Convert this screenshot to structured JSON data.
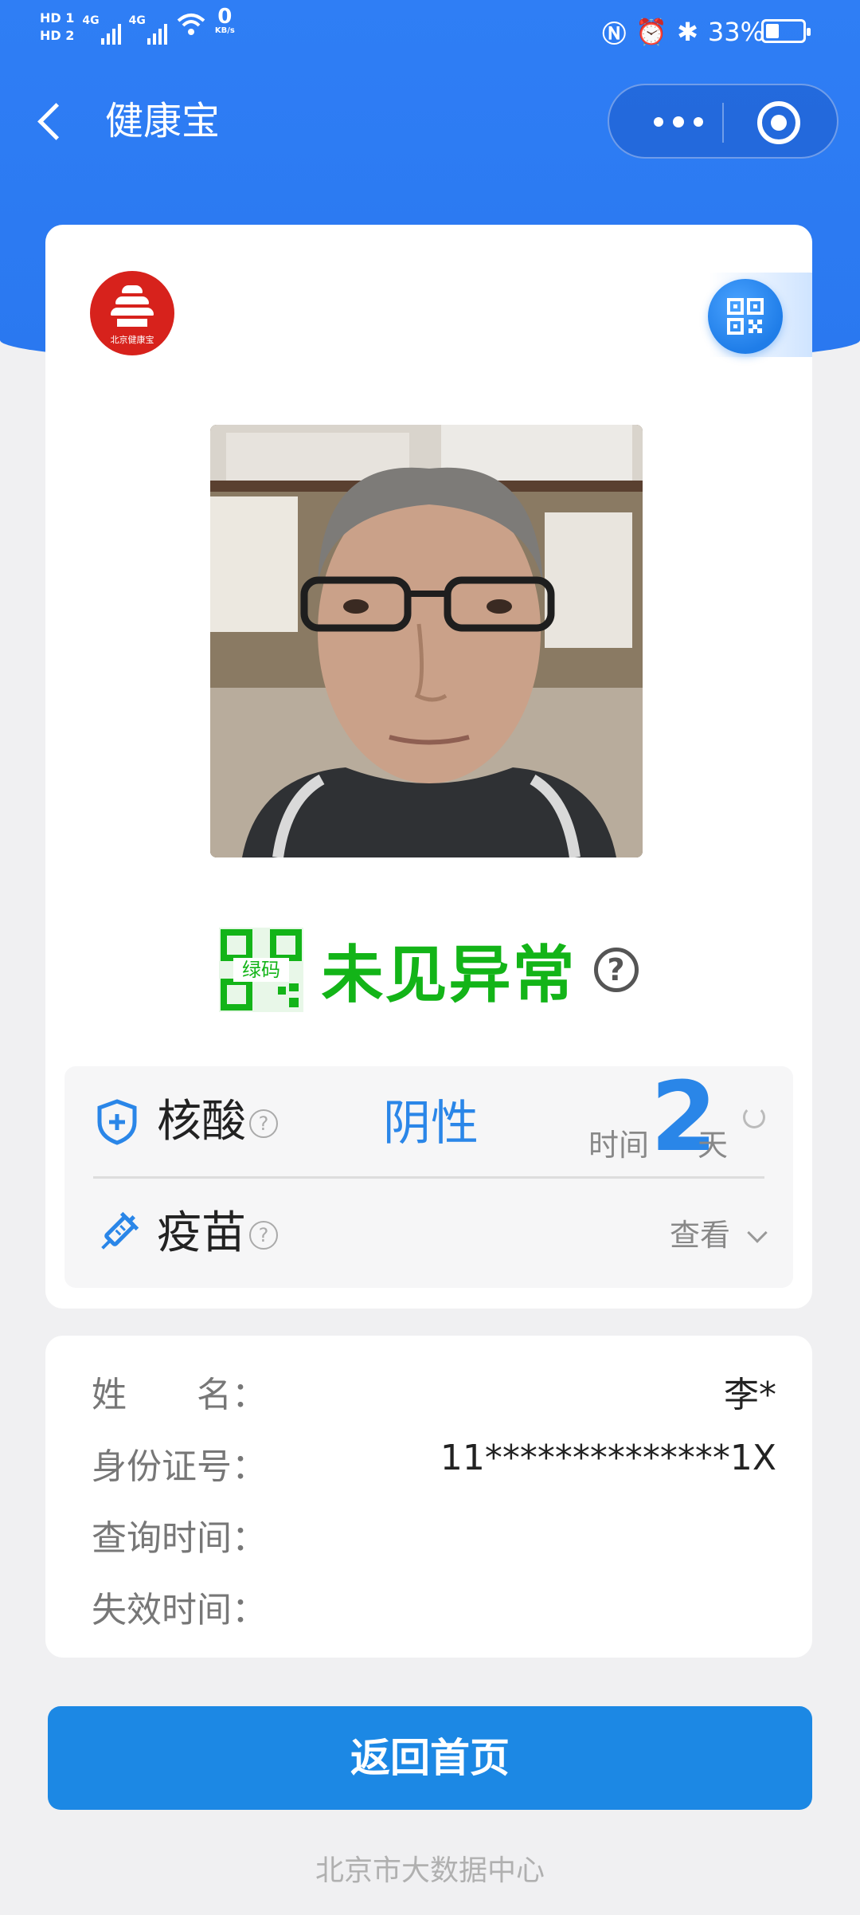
{
  "status_bar": {
    "hd1": "HD 1",
    "hd2": "HD 2",
    "net1": "4G",
    "net2": "4G",
    "speed": "0",
    "speed_unit": "KB/s",
    "battery_percent": "33%"
  },
  "nav": {
    "title": "健康宝"
  },
  "logo": {
    "text": "北京健康宝"
  },
  "health": {
    "code_label": "绿码",
    "status_text": "未见异常",
    "code_color": "#13b418",
    "help_glyph": "?"
  },
  "tests": {
    "nucleic": {
      "label": "核酸",
      "result": "阴性",
      "time_label": "时间",
      "days": "2",
      "days_unit": "天"
    },
    "vaccine": {
      "label": "疫苗",
      "action": "查看"
    }
  },
  "info": {
    "name_key": "姓　　名：",
    "name_value": "李*",
    "id_key": "身份证号：",
    "id_value": "11**************1X",
    "query_key": "查询时间：",
    "expire_key": "失效时间："
  },
  "home_button": "返回首页",
  "footer": "北京市大数据中心",
  "colors": {
    "brand_blue": "#2f7ef5",
    "accent_blue": "#2a86e8",
    "green": "#13b418"
  }
}
